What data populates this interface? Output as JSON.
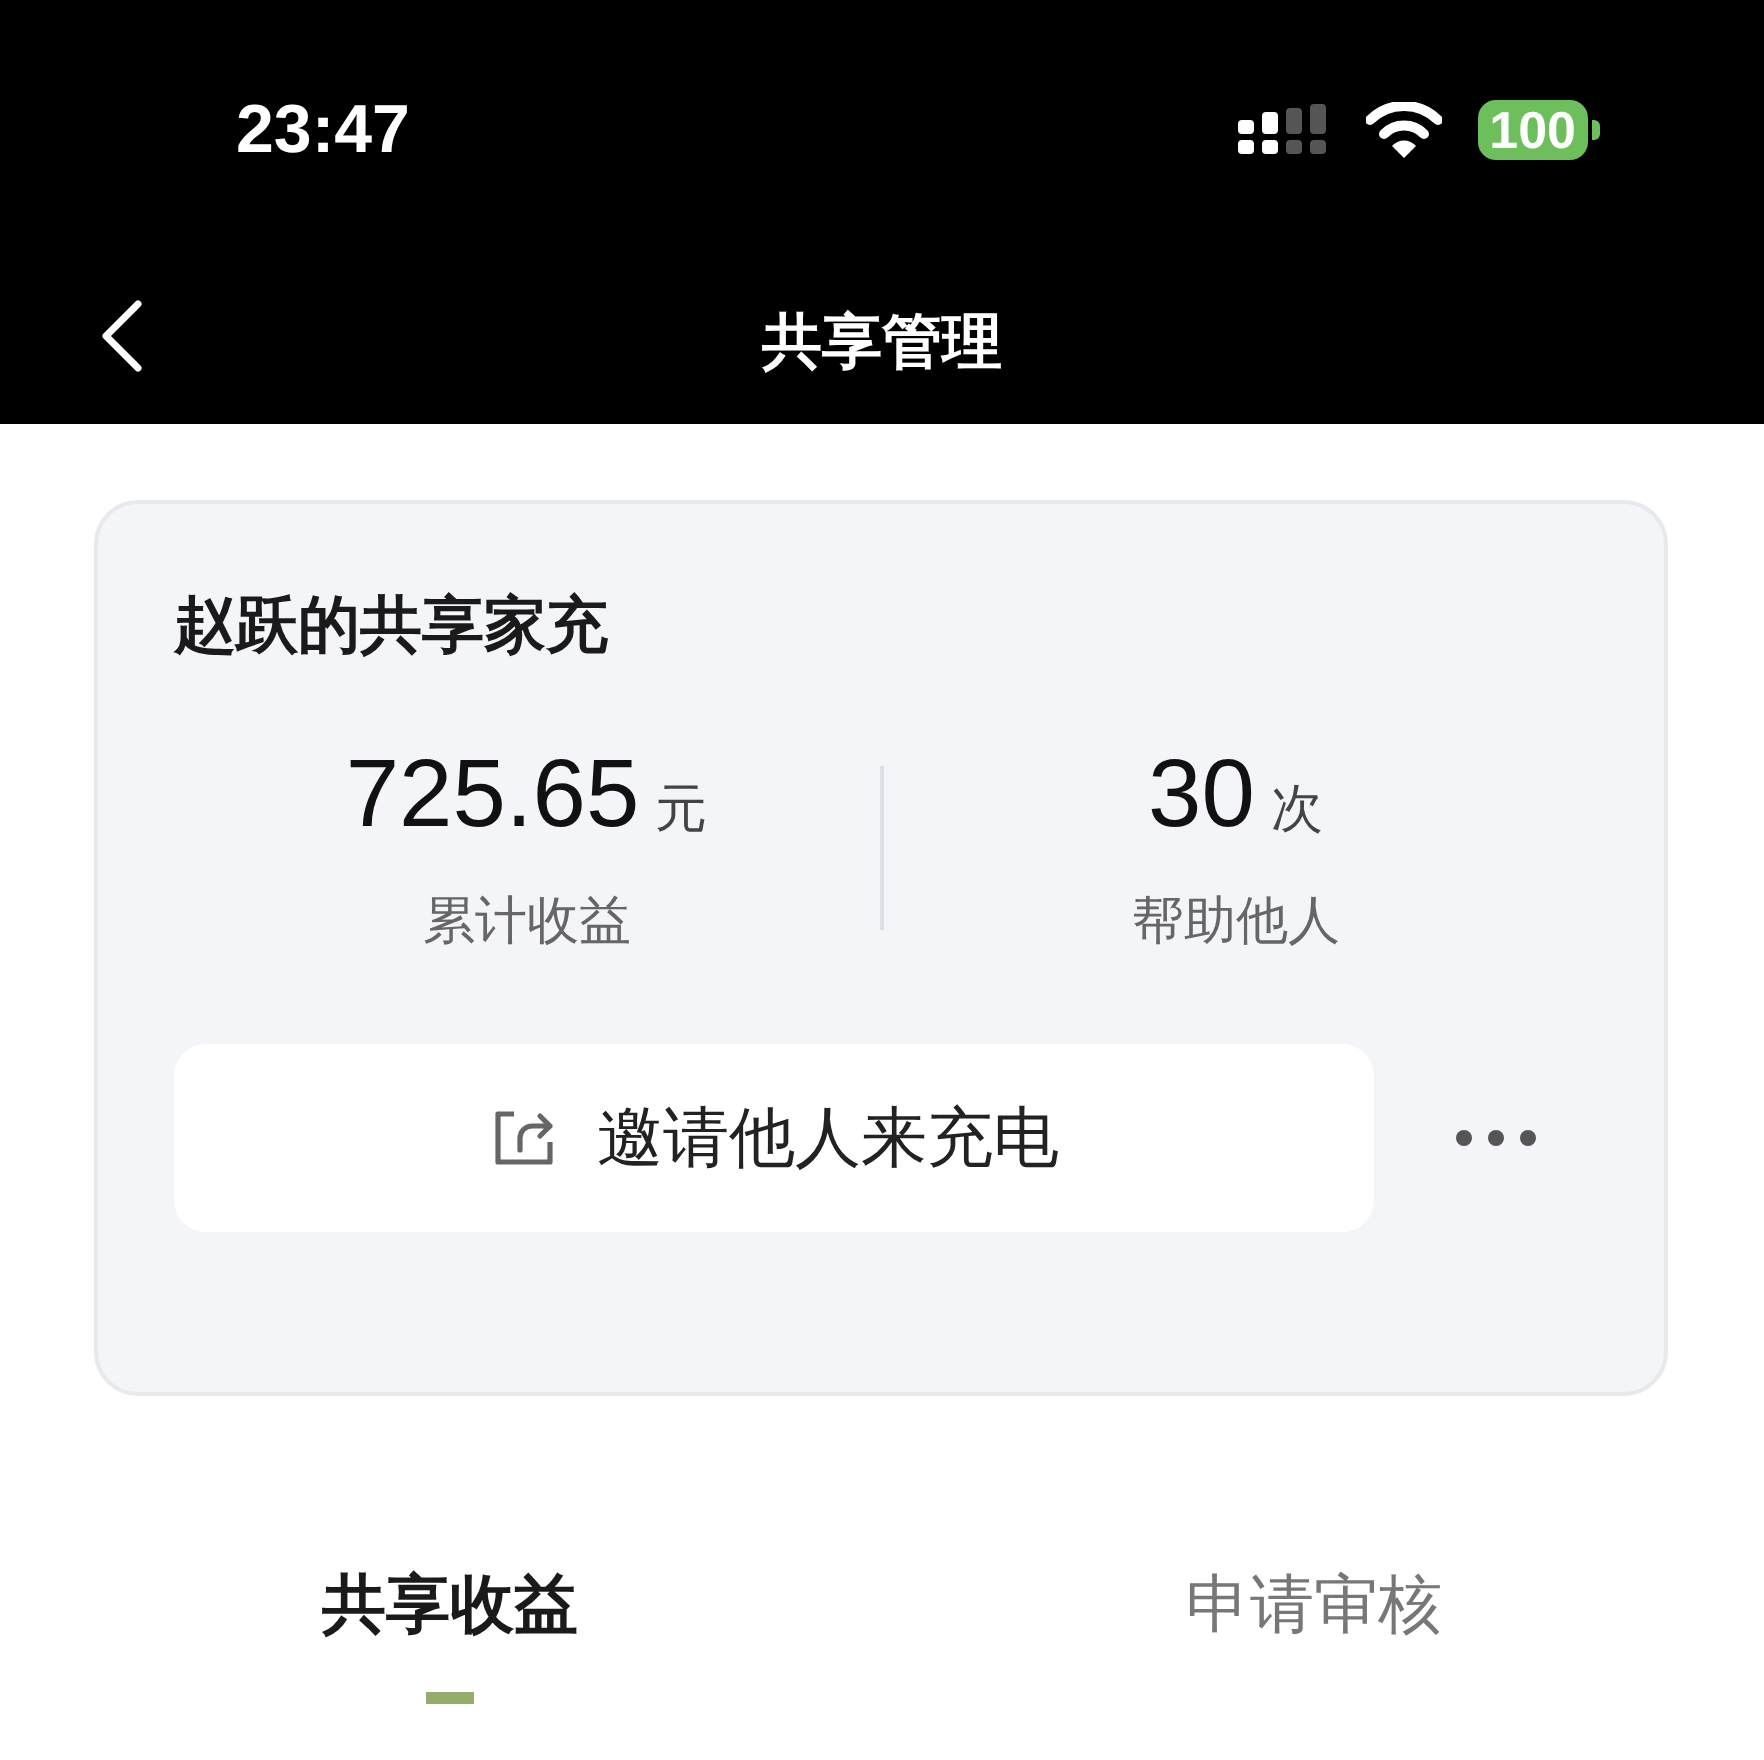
{
  "status_bar": {
    "time": "23:47",
    "battery": "100"
  },
  "nav": {
    "title": "共享管理"
  },
  "card": {
    "title": "赵跃的共享家充",
    "stats": [
      {
        "value": "725.65",
        "unit": "元",
        "label": "累计收益"
      },
      {
        "value": "30",
        "unit": "次",
        "label": "帮助他人"
      }
    ],
    "invite_button": "邀请他人来充电"
  },
  "tabs": [
    {
      "label": "共享收益",
      "selected": true
    },
    {
      "label": "申请审核",
      "selected": false
    }
  ]
}
